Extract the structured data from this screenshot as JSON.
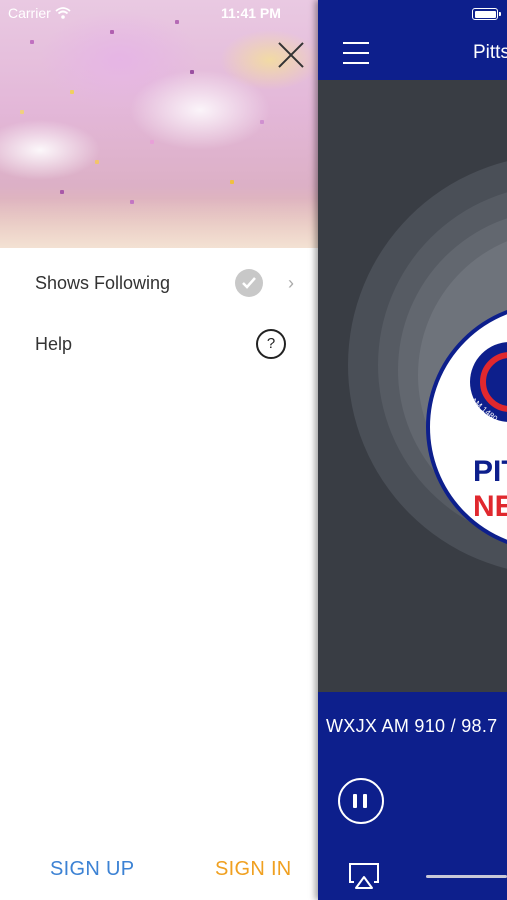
{
  "status_bar": {
    "carrier": "Carrier",
    "time": "11:41 PM"
  },
  "menu": {
    "items": [
      {
        "label": "Shows Following",
        "icon": "checkmark-circle-icon"
      },
      {
        "label": "Help",
        "icon": "question-circle-icon"
      }
    ]
  },
  "auth": {
    "sign_up": "SIGN UP",
    "sign_in": "SIGN IN"
  },
  "player": {
    "header_title": "Pitts",
    "logo_text_top": "PIT",
    "logo_text_bottom": "NE",
    "logo_small": "AM 1480",
    "station_line": "WXJX AM 910 / 98.7"
  },
  "colors": {
    "brand_blue": "#0d1f8c",
    "sign_up": "#3c82d4",
    "sign_in": "#f0a020",
    "news_red": "#e0282e"
  }
}
